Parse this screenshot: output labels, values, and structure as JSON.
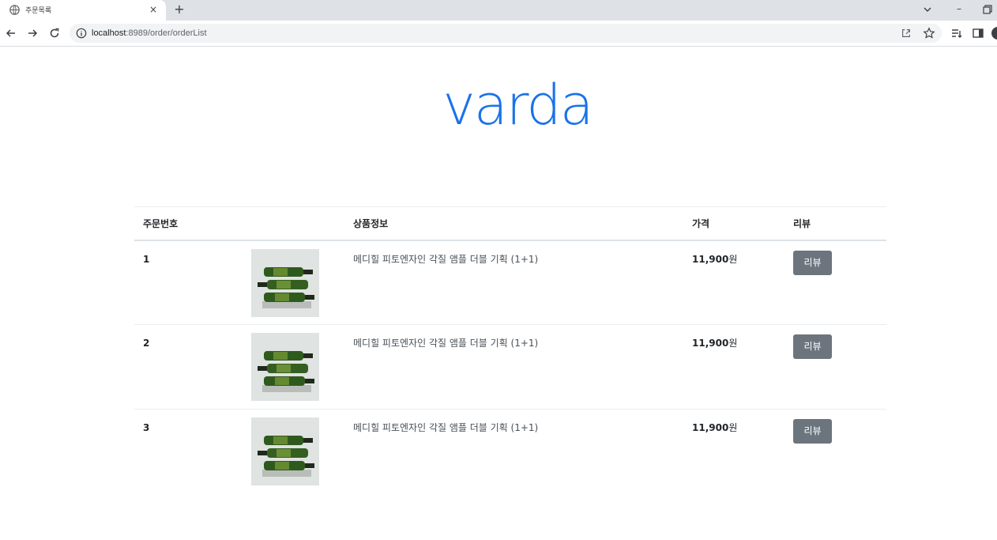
{
  "browser": {
    "tab_title": "주문목록",
    "url_host": "localhost",
    "url_path": ":8989/order/orderList",
    "new_tab_symbol": "+",
    "close_symbol": "×",
    "minimize_symbol": "–"
  },
  "page": {
    "brand": "varda"
  },
  "table": {
    "headers": {
      "order_no": "주문번호",
      "image": "",
      "product": "상품정보",
      "price": "가격",
      "review": "리뷰"
    },
    "rows": [
      {
        "order_no": "1",
        "product": "메디힐 피토엔자인 각질 앰플 더블 기획 (1+1)",
        "price_amount": "11,900",
        "price_unit": "원",
        "review_label": "리뷰"
      },
      {
        "order_no": "2",
        "product": "메디힐 피토엔자인 각질 앰플 더블 기획 (1+1)",
        "price_amount": "11,900",
        "price_unit": "원",
        "review_label": "리뷰"
      },
      {
        "order_no": "3",
        "product": "메디힐 피토엔자인 각질 앰플 더블 기획 (1+1)",
        "price_amount": "11,900",
        "price_unit": "원",
        "review_label": "리뷰"
      }
    ]
  },
  "icons": [
    "globe-icon",
    "back-icon",
    "forward-icon",
    "reload-icon",
    "site-info-icon",
    "share-icon",
    "bookmark-star-icon",
    "reading-list-icon",
    "side-panel-icon",
    "tab-search-icon",
    "restore-icon",
    "profile-avatar"
  ],
  "colors": {
    "brand": "#1a73e8",
    "review_button": "#6c757d",
    "tabstrip": "#dee1e6",
    "omnibox": "#f1f3f4"
  }
}
